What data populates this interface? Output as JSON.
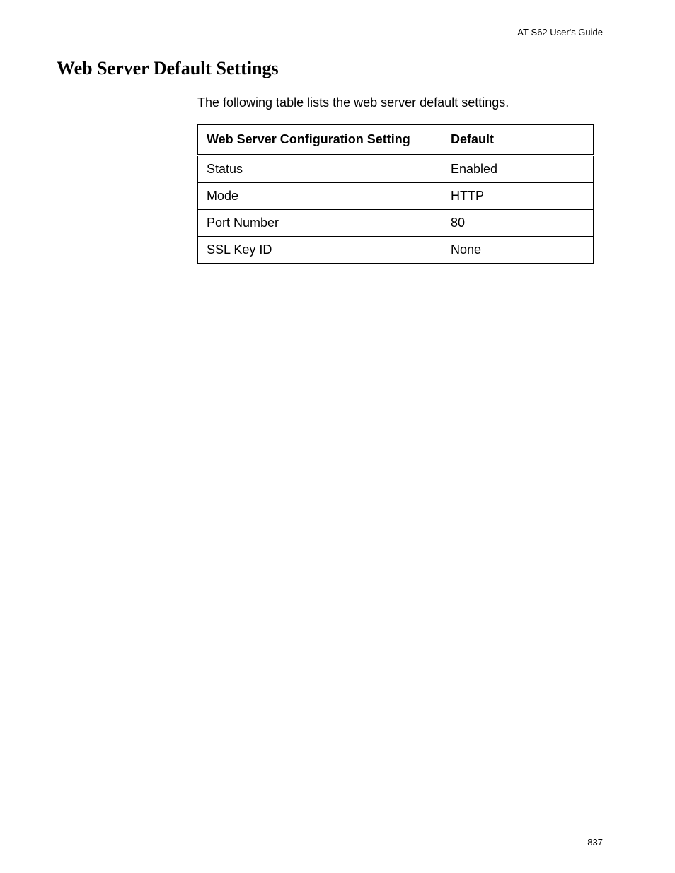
{
  "header": {
    "guide_name": "AT-S62 User's Guide"
  },
  "section": {
    "title": "Web Server Default Settings",
    "intro": "The following table lists the web server default settings."
  },
  "table": {
    "headers": {
      "setting": "Web Server Configuration Setting",
      "default": "Default"
    },
    "rows": [
      {
        "setting": "Status",
        "default": "Enabled"
      },
      {
        "setting": "Mode",
        "default": "HTTP"
      },
      {
        "setting": "Port Number",
        "default": "80"
      },
      {
        "setting": "SSL Key ID",
        "default": "None"
      }
    ]
  },
  "footer": {
    "page_number": "837"
  }
}
